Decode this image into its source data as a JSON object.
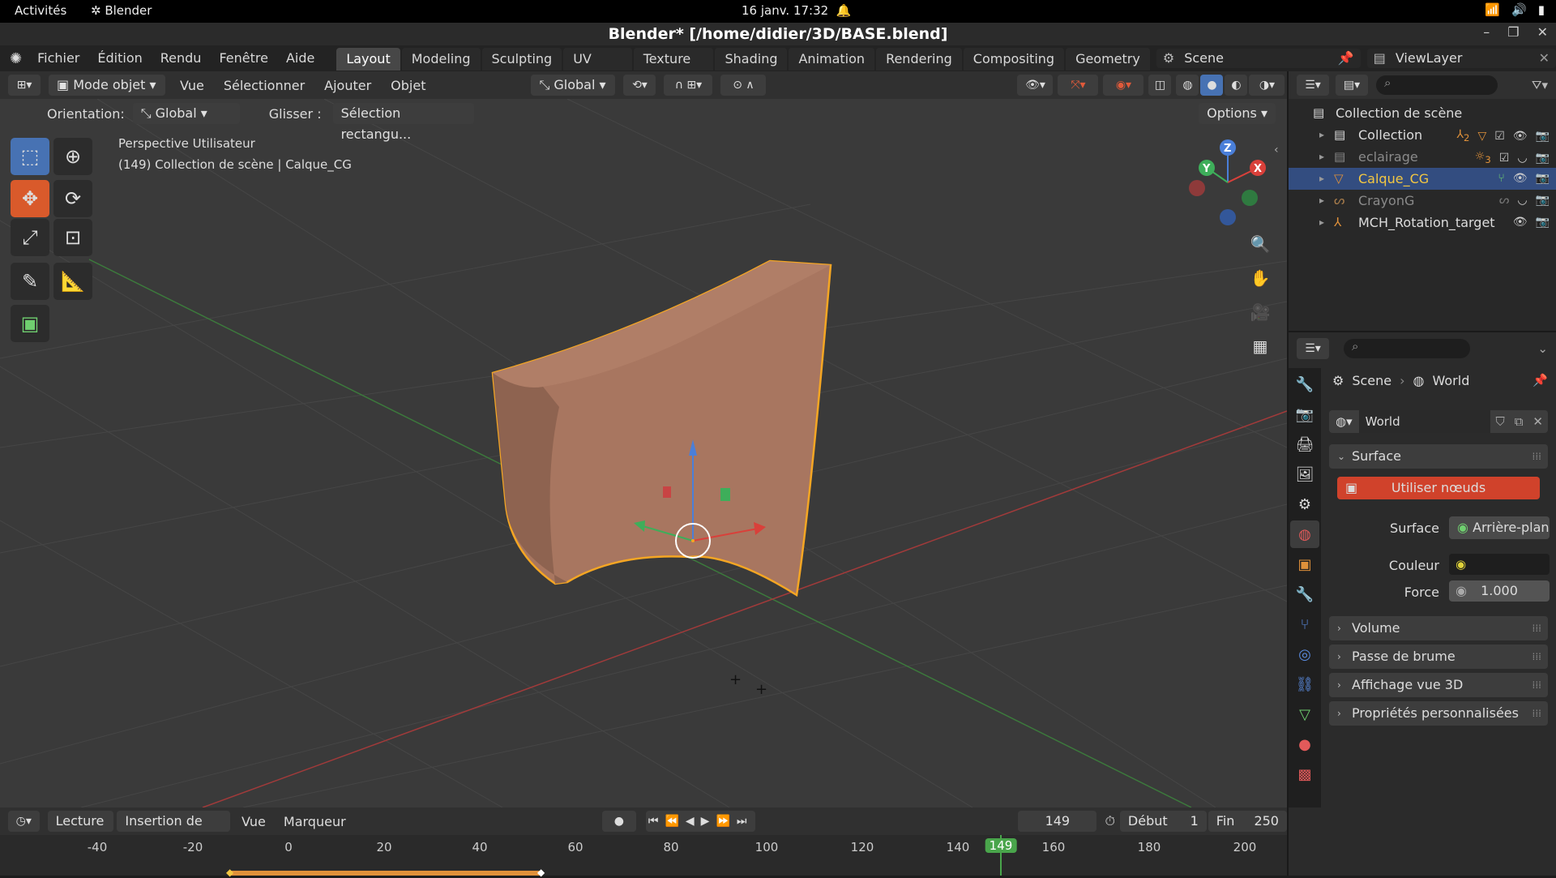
{
  "gnome": {
    "activities": "Activités",
    "app": "Blender",
    "clock": "16 janv.  17:32"
  },
  "window": {
    "title": "Blender* [/home/didier/3D/BASE.blend]"
  },
  "menu": {
    "items": [
      "Fichier",
      "Édition",
      "Rendu",
      "Fenêtre",
      "Aide"
    ],
    "workspaces": [
      "Layout",
      "Modeling",
      "Sculpting",
      "UV Editing",
      "Texture Paint",
      "Shading",
      "Animation",
      "Rendering",
      "Compositing",
      "Geometry Nc"
    ],
    "active_workspace": "Layout",
    "scene": "Scene",
    "view_layer": "ViewLayer"
  },
  "viewport_header": {
    "mode": "Mode objet",
    "menus": [
      "Vue",
      "Sélectionner",
      "Ajouter",
      "Objet"
    ],
    "transform_orientation": "Global"
  },
  "tool_settings": {
    "orientation_label": "Orientation:",
    "orientation_value": "Global",
    "drag_label": "Glisser :",
    "drag_value": "Sélection rectangu...",
    "options": "Options"
  },
  "viewport": {
    "view_name": "Perspective Utilisateur",
    "context": "(149) Collection de scène | Calque_CG",
    "gizmo": {
      "x": "X",
      "y": "Y",
      "z": "Z"
    },
    "colors": {
      "object": "#a5735a",
      "outline": "#f5a623",
      "x_axis": "#a23a3a",
      "y_axis": "#3c7a3c"
    }
  },
  "outliner": {
    "root": "Collection de scène",
    "items": [
      {
        "name": "Collection",
        "color": "#dcdcdc",
        "badge": "2"
      },
      {
        "name": "eclairage",
        "color": "#8a8a8a",
        "badge": "3"
      },
      {
        "name": "Calque_CG",
        "color": "#f3c742",
        "badge": ""
      },
      {
        "name": "CrayonG",
        "color": "#8a8a8a",
        "badge": ""
      },
      {
        "name": "MCH_Rotation_target",
        "color": "#dcdcdc",
        "badge": ""
      }
    ]
  },
  "properties": {
    "breadcrumb_scene": "Scene",
    "breadcrumb_world": "World",
    "world_name": "World",
    "surface_panel": "Surface",
    "use_nodes": "Utiliser nœuds",
    "surface_label": "Surface",
    "surface_value": "Arrière-plan",
    "color_label": "Couleur",
    "strength_label": "Force",
    "strength_value": "1.000",
    "panels": [
      "Volume",
      "Passe de brume",
      "Affichage vue 3D",
      "Propriétés personnalisées"
    ]
  },
  "timeline": {
    "playback": "Lecture",
    "keying": "Insertion de clés",
    "view": "Vue",
    "marker": "Marqueur",
    "current_frame": "149",
    "start_label": "Début",
    "start": "1",
    "end_label": "Fin",
    "end": "250",
    "ticks": [
      "-40",
      "-20",
      "0",
      "20",
      "40",
      "60",
      "80",
      "100",
      "120",
      "140",
      "160",
      "180",
      "200"
    ],
    "playhead": "149"
  }
}
